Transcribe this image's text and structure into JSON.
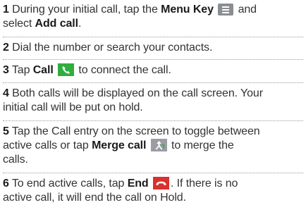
{
  "steps": [
    {
      "num": "1",
      "t1": " During your initial call, tap the ",
      "b1": "Menu Key",
      "t2": " and",
      "t3": "select ",
      "b2": "Add call",
      "t4": ".",
      "icon": "menu-key-icon"
    },
    {
      "num": "2",
      "t1": " Dial the number or search your contacts."
    },
    {
      "num": "3",
      "t1": " Tap ",
      "b1": "Call",
      "t2": " to connect the call.",
      "icon": "call-icon"
    },
    {
      "num": "4",
      "t1": " Both calls will be displayed on the call screen. Your",
      "t2": "initial call will be put on hold."
    },
    {
      "num": "5",
      "t1": " Tap the Call entry on the screen to toggle between",
      "t2": "active calls or tap ",
      "b1": "Merge call",
      "t3": " to merge the",
      "t4": "calls.",
      "icon": "merge-call-icon"
    },
    {
      "num": "6",
      "t1": " To end active calls, tap ",
      "b1": "End",
      "t2": ". If there is no",
      "t3": "active call, it will end the call on Hold.",
      "icon": "end-call-icon"
    }
  ],
  "colors": {
    "call_icon": "#2fae3e",
    "end_icon": "#d8312e",
    "menu_icon": "#8a8d92"
  }
}
